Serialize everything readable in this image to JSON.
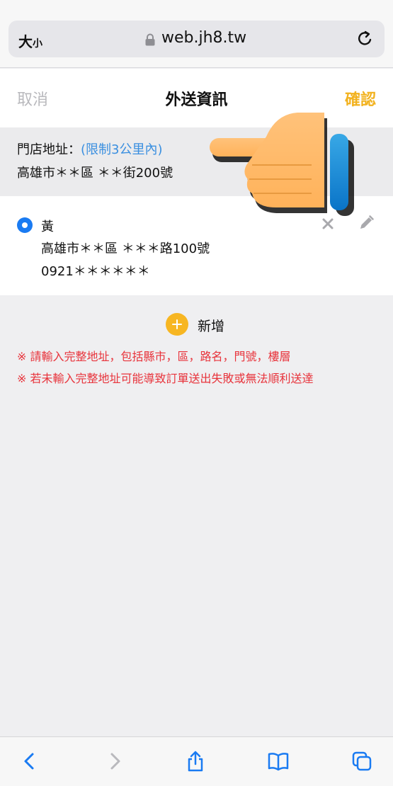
{
  "browser": {
    "text_size_label_big": "大",
    "text_size_label_small": "小",
    "url": "web.jh8.tw"
  },
  "header": {
    "cancel_label": "取消",
    "title": "外送資訊",
    "confirm_label": "確認"
  },
  "store": {
    "label": "門店地址：",
    "limit": "(限制3公里內)",
    "address": "高雄市＊＊區 ＊＊街200號"
  },
  "delivery": {
    "name": "黃",
    "address": "高雄市＊＊區 ＊＊＊路100號",
    "phone": "0921＊＊＊＊＊＊",
    "selected": true
  },
  "add": {
    "label": "新增"
  },
  "notices": [
    "※ 請輸入完整地址，包括縣市，區，路名，門號，樓層",
    "※ 若未輸入完整地址可能導致訂單送出失敗或無法順利送達"
  ],
  "colors": {
    "accent_confirm": "#f2b21e",
    "accent_blue": "#1a7bf2",
    "warning": "#e8333b",
    "limit_link": "#3a8fe0"
  },
  "icons": [
    "lock-icon",
    "reload-icon",
    "delete-icon",
    "edit-icon",
    "plus-icon",
    "pointing-hand-icon",
    "back-icon",
    "forward-icon",
    "share-icon",
    "bookmarks-icon",
    "tabs-icon"
  ]
}
